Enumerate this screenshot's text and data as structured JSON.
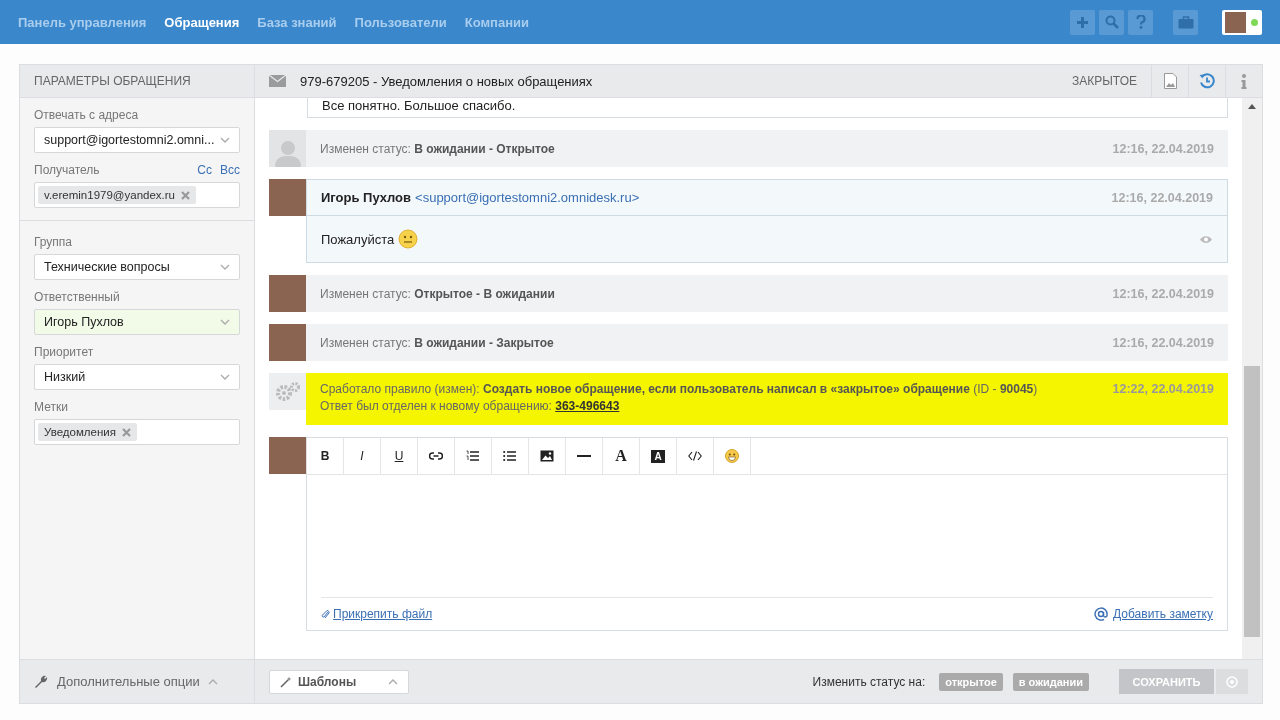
{
  "nav": {
    "items": [
      {
        "label": "Панель управления",
        "selected": false
      },
      {
        "label": "Обращения",
        "selected": true
      },
      {
        "label": "База знаний",
        "selected": false
      },
      {
        "label": "Пользователи",
        "selected": false
      },
      {
        "label": "Компании",
        "selected": false
      }
    ],
    "user_online": true
  },
  "ticket": {
    "title": "979-679205 - Уведомления о новых обращениях",
    "status": "ЗАКРЫТОЕ"
  },
  "sidebar": {
    "title": "ПАРАМЕТРЫ ОБРАЩЕНИЯ",
    "reply_from": {
      "label": "Отвечать с адреса",
      "value": "support@igortestomni2.omni..."
    },
    "recipient": {
      "label": "Получатель",
      "links": [
        "Cc",
        "Bcc"
      ],
      "tags": [
        "v.eremin1979@yandex.ru"
      ]
    },
    "fields": [
      {
        "label": "Группа",
        "value": "Технические вопросы",
        "highlighted": false
      },
      {
        "label": "Ответственный",
        "value": "Игорь Пухлов",
        "highlighted": true
      },
      {
        "label": "Приоритет",
        "value": "Низкий",
        "highlighted": false
      }
    ],
    "labels": {
      "label": "Метки",
      "tags": [
        "Уведомления"
      ]
    },
    "more_options": "Дополнительные опции"
  },
  "timeline": [
    {
      "kind": "tail",
      "text": "Все понятно. Большое спасибо."
    },
    {
      "kind": "status",
      "avatar": {
        "kind": "placeholder"
      },
      "prefix": "Изменен статус:",
      "value": "В ожидании - Открытое",
      "time": "12:16, 22.04.2019"
    },
    {
      "kind": "message",
      "avatar": {
        "kind": "photo"
      },
      "author": "Игорь Пухлов",
      "email": "<support@igortestomni2.omnidesk.ru>",
      "time": "12:16, 22.04.2019",
      "text": "Пожалуйста"
    },
    {
      "kind": "status",
      "avatar": {
        "kind": "photo"
      },
      "prefix": "Изменен статус:",
      "value": "Открытое - В ожидании",
      "time": "12:16, 22.04.2019"
    },
    {
      "kind": "status",
      "avatar": {
        "kind": "photo"
      },
      "prefix": "Изменен статус:",
      "value": "В ожидании - Закрытое",
      "time": "12:16, 22.04.2019"
    },
    {
      "kind": "rule",
      "avatar": {
        "kind": "gears"
      },
      "text": "Сработало правило (измен): **Создать новое обращение, если пользователь написал в «закрытое» обращение** (ID - **90045**)",
      "line2": "Ответ был отделен к новому обращению:",
      "link": "363-496643",
      "time": "12:22, 22.04.2019"
    }
  ],
  "editor": {
    "toolbar": [
      {
        "kind": "bold",
        "label": "B"
      },
      {
        "kind": "italic",
        "label": "I"
      },
      {
        "kind": "underline",
        "label": "U"
      },
      {
        "kind": "link"
      },
      {
        "kind": "ordered-list"
      },
      {
        "kind": "bullet-list"
      },
      {
        "kind": "image"
      },
      {
        "kind": "rule"
      },
      {
        "kind": "font",
        "label": "A"
      },
      {
        "kind": "highlight",
        "label": "A"
      },
      {
        "kind": "code"
      },
      {
        "kind": "emoji"
      }
    ],
    "attach": "Прикрепить файл",
    "note": "Добавить заметку"
  },
  "footer": {
    "templates": "Шаблоны",
    "status_label": "Изменить статус на:",
    "status_buttons": [
      "открытое",
      "в ожидании"
    ],
    "save": {
      "label": "СОХРАНИТЬ",
      "disabled": true
    }
  }
}
